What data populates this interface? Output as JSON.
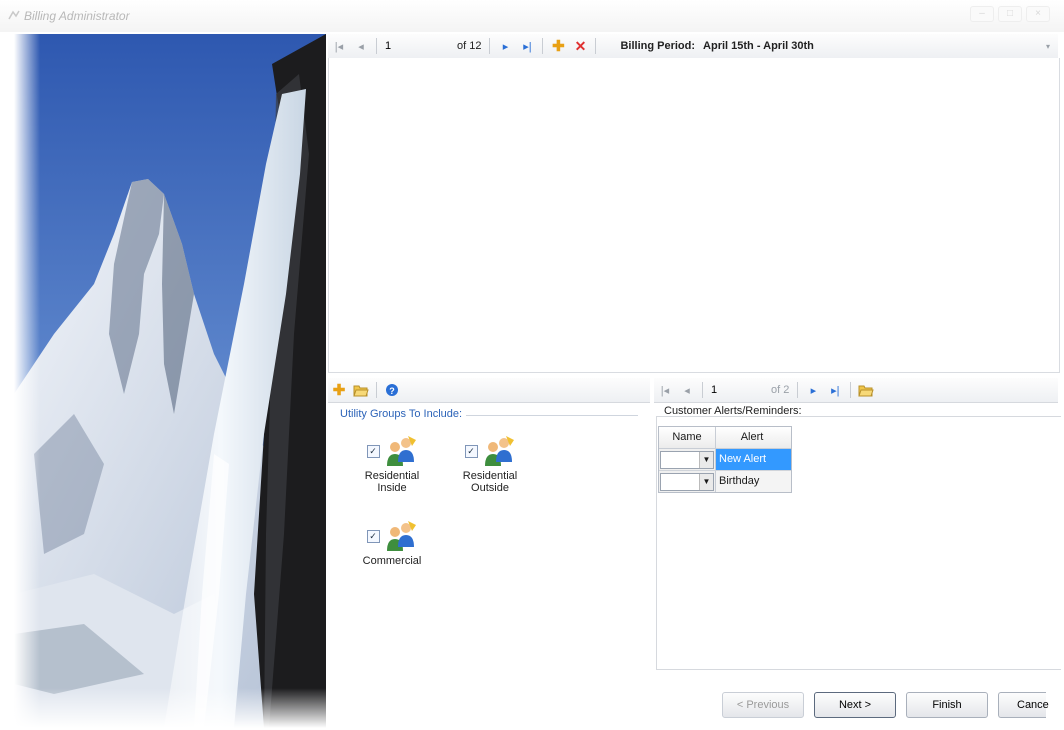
{
  "window": {
    "title": "Billing Administrator"
  },
  "top_navigator": {
    "position": "1",
    "of_text": "of 12",
    "billing_period_label": "Billing Period:",
    "billing_period_value": "April 15th - April 30th"
  },
  "utility_groups": {
    "label": "Utility Groups To Include:",
    "items": [
      {
        "label_line1": "Residential",
        "label_line2": "Inside",
        "checked": true
      },
      {
        "label_line1": "Residential",
        "label_line2": "Outside",
        "checked": true
      },
      {
        "label_line1": "Commercial",
        "label_line2": "",
        "checked": true
      }
    ]
  },
  "alerts_navigator": {
    "position": "1",
    "of_text": "of 2"
  },
  "alerts": {
    "label": "Customer Alerts/Reminders:",
    "columns": [
      "Name",
      "Alert"
    ],
    "rows": [
      {
        "name": "",
        "alert": "New Alert",
        "selected": true
      },
      {
        "name": "",
        "alert": "Birthday",
        "selected": false
      }
    ]
  },
  "buttons": {
    "previous": "< Previous",
    "next": "Next >",
    "finish": "Finish",
    "cancel": "Cance"
  },
  "colors": {
    "accent": "#2a6fd6",
    "selection": "#3399ff",
    "group_label": "#2c63b8",
    "delete": "#e03030",
    "add": "#e8a014"
  },
  "icons": [
    "app-icon",
    "first-record-icon",
    "previous-record-icon",
    "next-record-icon",
    "last-record-icon",
    "add-icon",
    "delete-icon",
    "open-folder-icon",
    "help-icon",
    "users-group-icon",
    "dropdown-arrow-icon"
  ]
}
